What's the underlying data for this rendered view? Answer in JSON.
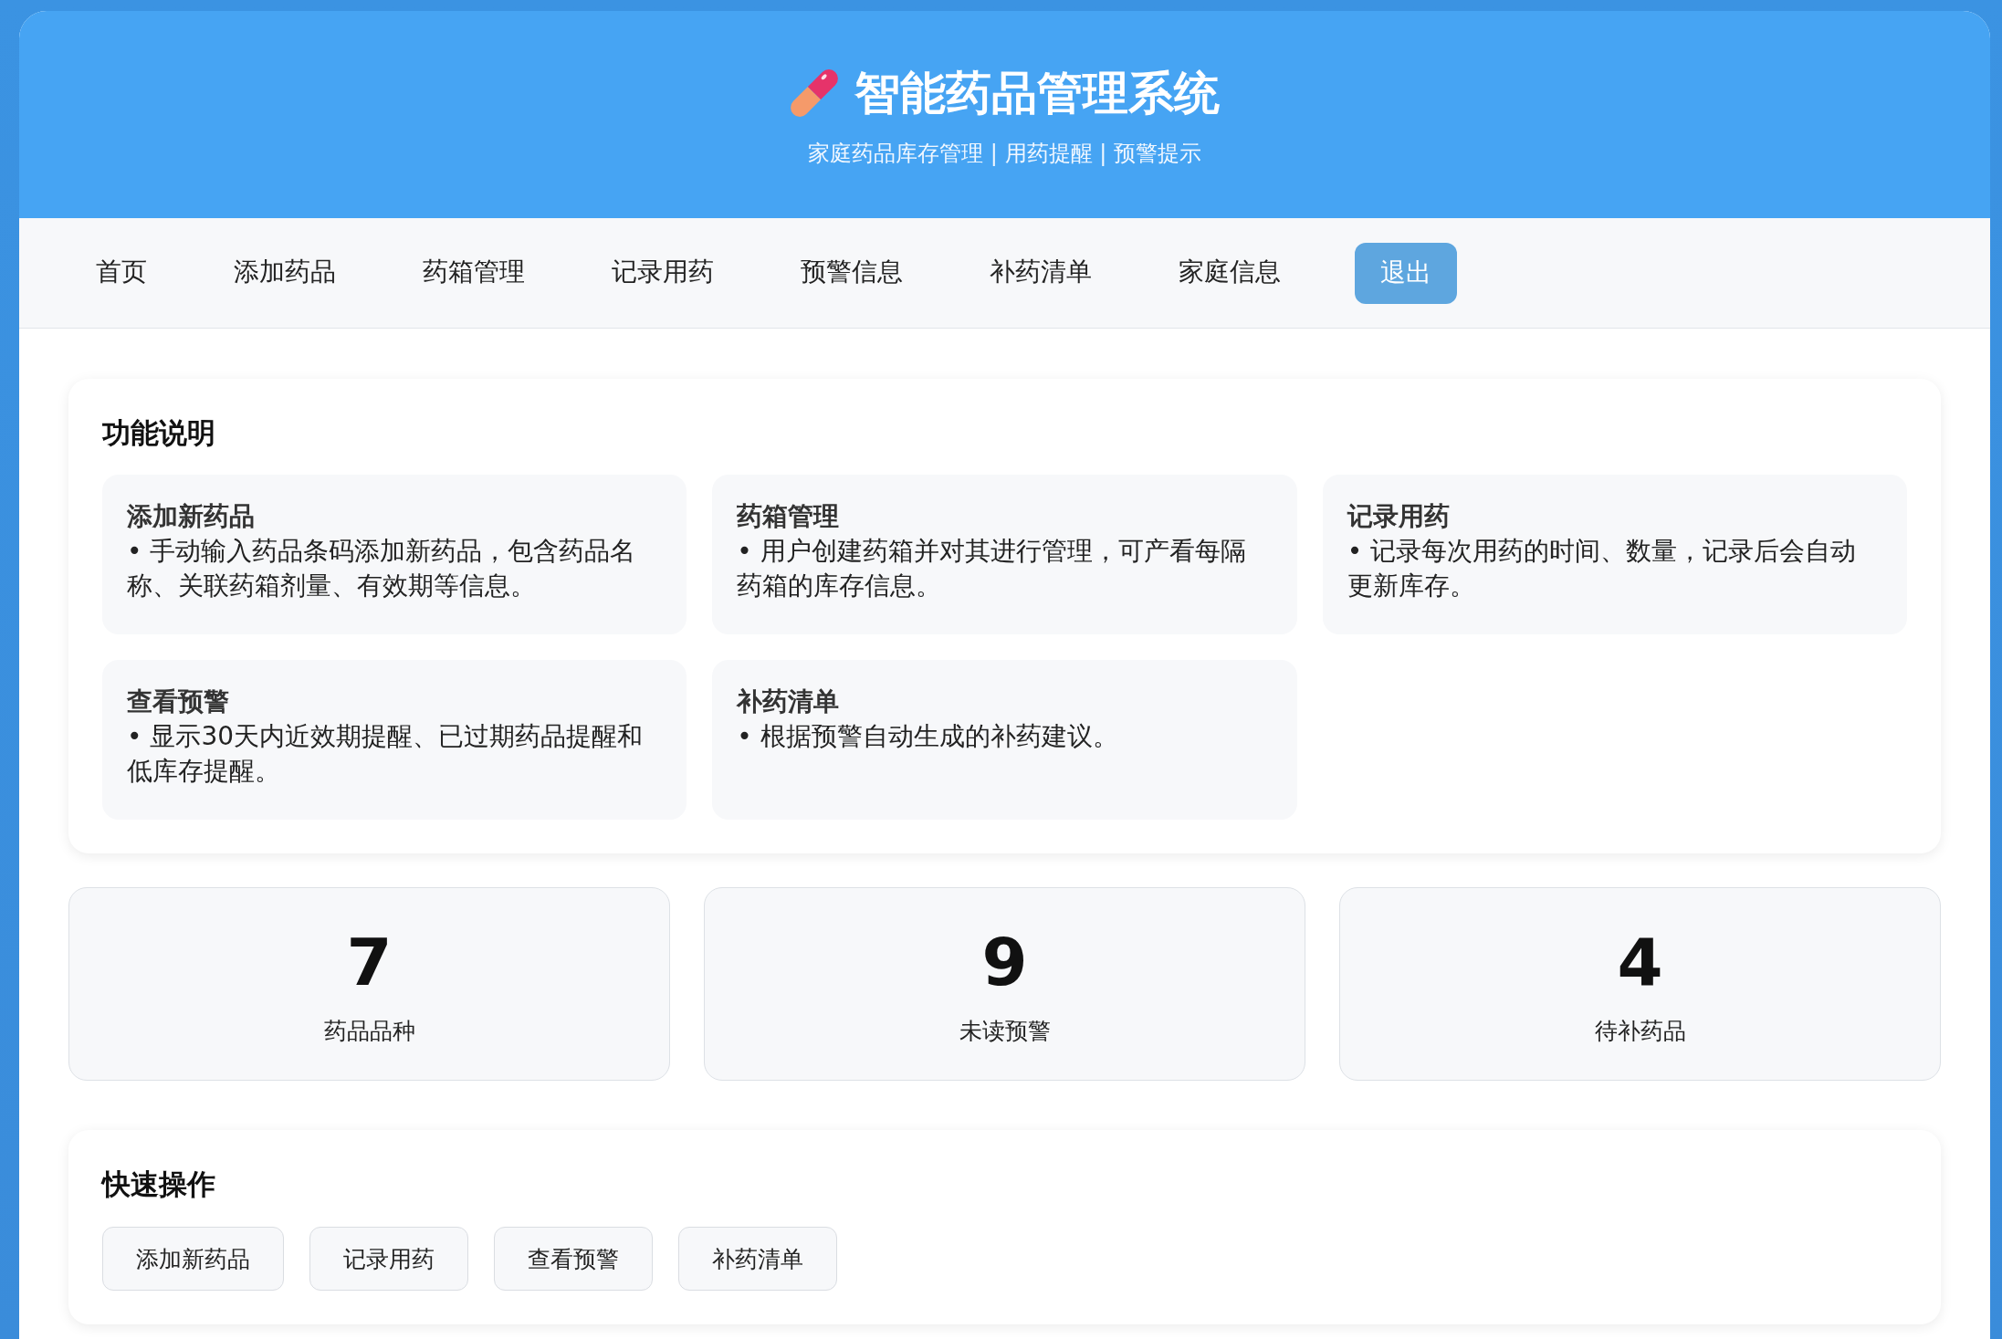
{
  "header": {
    "title": "智能药品管理系统",
    "subtitle": "家庭药品库存管理 | 用药提醒 | 预警提示"
  },
  "nav": {
    "items": [
      {
        "label": "首页",
        "selected": false
      },
      {
        "label": "添加药品",
        "selected": false
      },
      {
        "label": "药箱管理",
        "selected": false
      },
      {
        "label": "记录用药",
        "selected": false
      },
      {
        "label": "预警信息",
        "selected": false
      },
      {
        "label": "补药清单",
        "selected": false
      },
      {
        "label": "家庭信息",
        "selected": false
      }
    ],
    "logout_button": "退出"
  },
  "features": {
    "title": "功能说明",
    "items": [
      {
        "title": "添加新药品",
        "description": "• 手动输入药品条码添加新药品，包含药品名称、关联药箱剂量、有效期等信息。"
      },
      {
        "title": "药箱管理",
        "description": "• 用户创建药箱并对其进行管理，可产看每隔药箱的库存信息。"
      },
      {
        "title": "记录用药",
        "description": "• 记录每次用药的时间、数量，记录后会自动更新库存。"
      },
      {
        "title": "查看预警",
        "description": "• 显示30天内近效期提醒、已过期药品提醒和低库存提醒。"
      },
      {
        "title": "补药清单",
        "description": "• 根据预警自动生成的补药建议。"
      }
    ]
  },
  "stats": [
    {
      "value": "7",
      "label": "药品品种"
    },
    {
      "value": "9",
      "label": "未读预警"
    },
    {
      "value": "4",
      "label": "待补药品"
    }
  ],
  "quick_actions": {
    "title": "快速操作",
    "buttons": [
      "添加新药品",
      "记录用药",
      "查看预警",
      "补药清单"
    ]
  }
}
